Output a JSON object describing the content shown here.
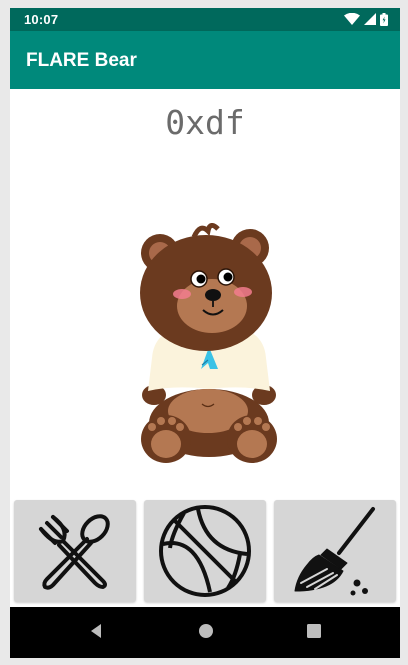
{
  "status_bar": {
    "time": "10:07",
    "icons": [
      "wifi-icon",
      "cell-signal-icon",
      "battery-icon"
    ]
  },
  "app_bar": {
    "title": "FLARE Bear",
    "color": "#00897b"
  },
  "main": {
    "value_text": "0xdf",
    "image": "bear-image"
  },
  "actions": [
    {
      "name": "feed",
      "icon": "fork-spoon-icon"
    },
    {
      "name": "play",
      "icon": "basketball-icon"
    },
    {
      "name": "clean",
      "icon": "broom-icon"
    }
  ],
  "navigation": {
    "buttons": [
      "back",
      "home",
      "recent-apps"
    ]
  },
  "colors": {
    "status_bar": "#00695c",
    "accent": "#00897b",
    "button_bg": "#d6d6d6",
    "bear_fur": "#6b3a1f"
  }
}
